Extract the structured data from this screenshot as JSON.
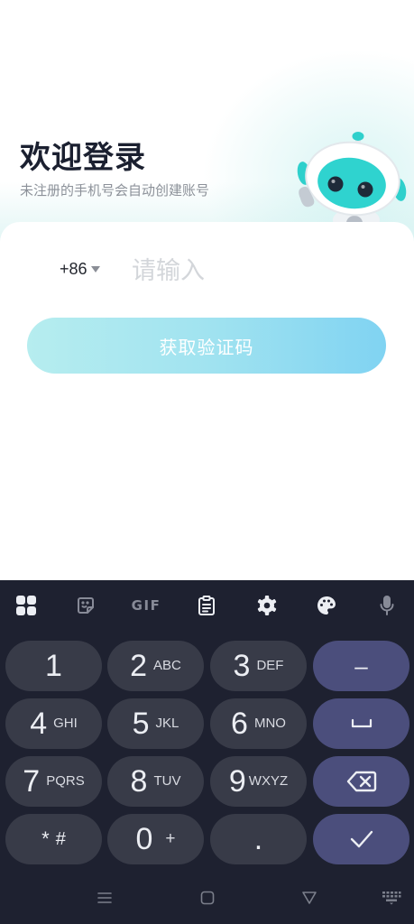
{
  "theme": {
    "title_color": "#1b2030",
    "accent_start": "#b6edef",
    "accent_end": "#80d3f2",
    "keyboard_bg": "#1e2130",
    "key_bg": "#383b48",
    "key_action_bg": "#4b4e7c"
  },
  "header": {
    "title": "欢迎登录",
    "subtitle": "未注册的手机号会自动创建账号",
    "mascot_icon": "robot-mascot-icon"
  },
  "login_form": {
    "country_code": "+86",
    "country_dropdown_icon": "caret-down-icon",
    "phone_placeholder": "请输入",
    "submit_label": "获取验证码"
  },
  "keyboard": {
    "toolbar": {
      "items": [
        {
          "icon": "apps-grid-icon"
        },
        {
          "icon": "sticker-icon"
        },
        {
          "icon": "gif-icon",
          "label": "GIF"
        },
        {
          "icon": "clipboard-icon"
        },
        {
          "icon": "settings-gear-icon"
        },
        {
          "icon": "palette-icon"
        },
        {
          "icon": "microphone-icon"
        }
      ]
    },
    "rows": [
      [
        {
          "main": "1"
        },
        {
          "main": "2",
          "sub": "ABC"
        },
        {
          "main": "3",
          "sub": "DEF"
        },
        {
          "main": "–"
        }
      ],
      [
        {
          "main": "4",
          "sub": "GHI"
        },
        {
          "main": "5",
          "sub": "JKL"
        },
        {
          "main": "6",
          "sub": "MNO"
        },
        {
          "icon": "space-bar-icon"
        }
      ],
      [
        {
          "main": "7",
          "sub": "PQRS"
        },
        {
          "main": "8",
          "sub": "TUV"
        },
        {
          "main": "9",
          "sub": "WXYZ"
        },
        {
          "icon": "backspace-icon"
        }
      ],
      [
        {
          "main": "*",
          "sub": "#"
        },
        {
          "main": "0",
          "sub": "+"
        },
        {
          "main": "."
        },
        {
          "icon": "check-icon"
        }
      ]
    ]
  },
  "system_nav": {
    "items": [
      {
        "icon": "menu-icon"
      },
      {
        "icon": "home-square-icon"
      },
      {
        "icon": "back-triangle-icon"
      },
      {
        "icon": "keyboard-switch-icon"
      }
    ]
  }
}
